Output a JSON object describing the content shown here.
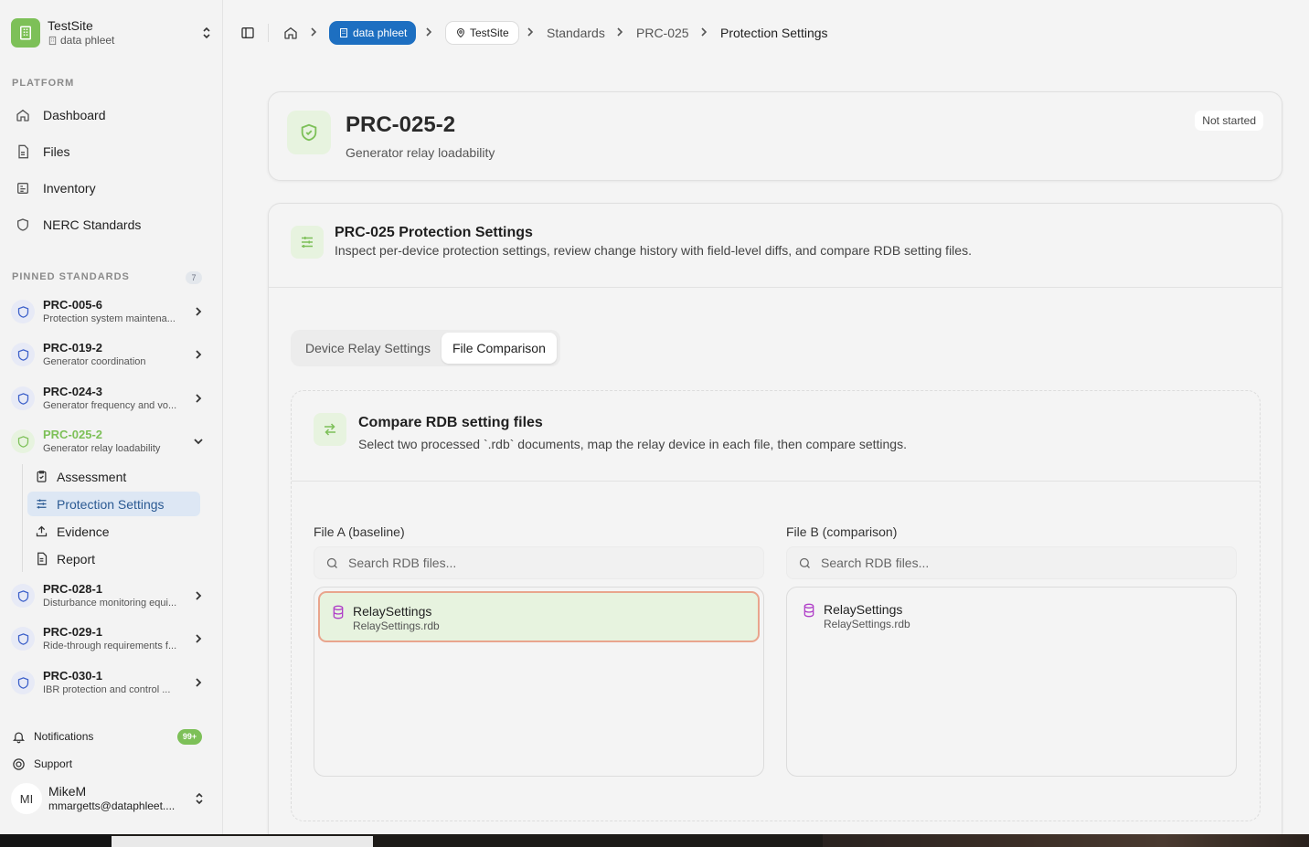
{
  "colors": {
    "accent_green": "#7dc058",
    "brand_blue": "#1d6fc1",
    "active_nav_bg": "#dde7f4",
    "selected_border": "#e9a58d"
  },
  "site": {
    "name": "TestSite",
    "org": "data phleet"
  },
  "sidebar": {
    "platform_label": "PLATFORM",
    "platform_items": [
      {
        "label": "Dashboard",
        "icon": "home-icon"
      },
      {
        "label": "Files",
        "icon": "file-icon"
      },
      {
        "label": "Inventory",
        "icon": "inventory-icon"
      },
      {
        "label": "NERC Standards",
        "icon": "shield-icon"
      }
    ],
    "pinned_label": "PINNED STANDARDS",
    "pinned_count": "7",
    "pinned": [
      {
        "code": "PRC-005-6",
        "desc": "Protection system maintena..."
      },
      {
        "code": "PRC-019-2",
        "desc": "Generator coordination"
      },
      {
        "code": "PRC-024-3",
        "desc": "Generator frequency and vo..."
      },
      {
        "code": "PRC-025-2",
        "desc": "Generator relay loadability"
      },
      {
        "code": "PRC-028-1",
        "desc": "Disturbance monitoring equi..."
      },
      {
        "code": "PRC-029-1",
        "desc": "Ride-through requirements f..."
      },
      {
        "code": "PRC-030-1",
        "desc": "IBR protection and control ..."
      }
    ],
    "sub_items": [
      {
        "label": "Assessment"
      },
      {
        "label": "Protection Settings"
      },
      {
        "label": "Evidence"
      },
      {
        "label": "Report"
      }
    ],
    "notifications": "Notifications",
    "notifications_count": "99+",
    "support": "Support",
    "user": {
      "initials": "MI",
      "name": "MikeM",
      "email": "mmargetts@dataphleet...."
    }
  },
  "breadcrumb": {
    "org": "data phleet",
    "site": "TestSite",
    "standards": "Standards",
    "family": "PRC-025",
    "current": "Protection Settings"
  },
  "header": {
    "title": "PRC-025-2",
    "subtitle": "Generator relay loadability",
    "status": "Not started"
  },
  "section": {
    "title": "PRC-025 Protection Settings",
    "desc": "Inspect per-device protection settings, review change history with field-level diffs, and compare RDB setting files."
  },
  "tabs": [
    {
      "label": "Device Relay Settings"
    },
    {
      "label": "File Comparison"
    }
  ],
  "compare": {
    "title": "Compare RDB setting files",
    "desc": "Select two processed `.rdb` documents, map the relay device in each file, then compare settings.",
    "file_a": {
      "label": "File A (baseline)",
      "placeholder": "Search RDB files...",
      "items": [
        {
          "name": "RelaySettings",
          "path": "RelaySettings.rdb"
        }
      ]
    },
    "file_b": {
      "label": "File B (comparison)",
      "placeholder": "Search RDB files...",
      "items": [
        {
          "name": "RelaySettings",
          "path": "RelaySettings.rdb"
        }
      ]
    }
  }
}
